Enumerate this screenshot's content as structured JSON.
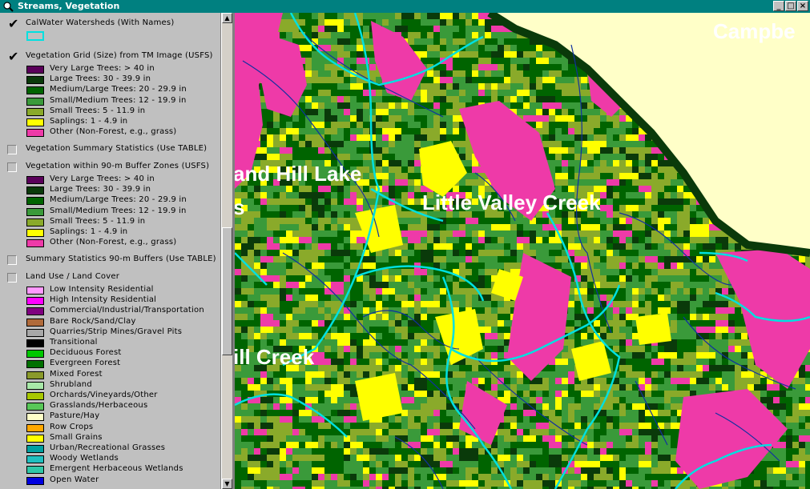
{
  "window": {
    "title": "Streams, Vegetation",
    "icon": "magnifier-globe-icon",
    "buttons": [
      "_",
      "□",
      "×"
    ]
  },
  "toc": {
    "layers": [
      {
        "name": "CalWater Watersheds (With Names)",
        "checked": true,
        "legend": [
          {
            "label": "",
            "color": "#c0c0c0",
            "outline": "#00e0e0"
          }
        ]
      },
      {
        "name": "Vegetation Grid (Size) from TM Image (USFS)",
        "checked": true,
        "legend": [
          {
            "label": "Very Large Trees: > 40  in",
            "color": "#5a005a"
          },
          {
            "label": "Large Trees: 30 - 39.9 in",
            "color": "#0a3a0a"
          },
          {
            "label": "Medium/Large Trees: 20 - 29.9 in",
            "color": "#006400"
          },
          {
            "label": "Small/Medium Trees: 12 - 19.9 in",
            "color": "#3a9a3a"
          },
          {
            "label": "Small Trees: 5 - 11.9 in",
            "color": "#8aaa2a"
          },
          {
            "label": "Saplings: 1 - 4.9 in",
            "color": "#ffff00"
          },
          {
            "label": "Other (Non-Forest, e.g., grass)",
            "color": "#ee3aa8"
          }
        ]
      },
      {
        "name": "Vegetation Summary Statistics (Use TABLE)",
        "checked": false,
        "legend": []
      },
      {
        "name": "Vegetation within 90-m Buffer Zones (USFS)",
        "checked": false,
        "legend": [
          {
            "label": "Very Large Trees: > 40  in",
            "color": "#5a005a"
          },
          {
            "label": "Large Trees: 30 - 39.9 in",
            "color": "#0a3a0a"
          },
          {
            "label": "Medium/Large Trees: 20 - 29.9 in",
            "color": "#006400"
          },
          {
            "label": "Small/Medium Trees: 12 - 19.9 in",
            "color": "#3a9a3a"
          },
          {
            "label": "Small Trees: 5 - 11.9 in",
            "color": "#8aaa2a"
          },
          {
            "label": "Saplings: 1 - 4.9 in",
            "color": "#ffff00"
          },
          {
            "label": "Other (Non-Forest, e.g., grass)",
            "color": "#ee3aa8"
          }
        ]
      },
      {
        "name": "Summary Statistics 90-m Buffers (Use TABLE)",
        "checked": false,
        "legend": []
      },
      {
        "name": "Land Use / Land Cover",
        "checked": false,
        "legend": [
          {
            "label": "Low Intensity Residential",
            "color": "#ff99ff"
          },
          {
            "label": "High Intensity Residential",
            "color": "#ff00ff"
          },
          {
            "label": "Commercial/Industrial/Transportation",
            "color": "#800080"
          },
          {
            "label": "Bare Rock/Sand/Clay",
            "color": "#b06a3a"
          },
          {
            "label": "Quarries/Strip Mines/Gravel Pits",
            "color": "#a8a8a8"
          },
          {
            "label": "Transitional",
            "color": "#000000"
          },
          {
            "label": "Deciduous Forest",
            "color": "#00c800"
          },
          {
            "label": "Evergreen Forest",
            "color": "#007000"
          },
          {
            "label": "Mixed Forest",
            "color": "#8a9a2a"
          },
          {
            "label": "Shrubland",
            "color": "#a8e8a8"
          },
          {
            "label": "Orchards/Vineyards/Other",
            "color": "#a8c800"
          },
          {
            "label": "Grasslands/Herbaceous",
            "color": "#58c858"
          },
          {
            "label": "Pasture/Hay",
            "color": "#ffffc8"
          },
          {
            "label": "Row Crops",
            "color": "#ffa800"
          },
          {
            "label": "Small Grains",
            "color": "#ffff00"
          },
          {
            "label": "Urban/Recreational Grasses",
            "color": "#00a0a0"
          },
          {
            "label": "Woody Wetlands",
            "color": "#20c0c0"
          },
          {
            "label": "Emergent Herbaceous Wetlands",
            "color": "#30c8a8"
          },
          {
            "label": "Open Water",
            "color": "#0000e0"
          }
        ]
      }
    ]
  },
  "map": {
    "labels": [
      "Campbe",
      "and Hill Lake",
      "s",
      "Little Valley Creek",
      "ill Creek"
    ],
    "colors": {
      "pink": "#ee3aa8",
      "yellow": "#ffff00",
      "dark_green": "#006400",
      "mid_green": "#3a9a3a",
      "olive": "#8aaa2a",
      "darkest": "#0a3a0a",
      "cream": "#ffffc8",
      "watershed": "#00e0e0",
      "stream": "#1030a0"
    }
  }
}
